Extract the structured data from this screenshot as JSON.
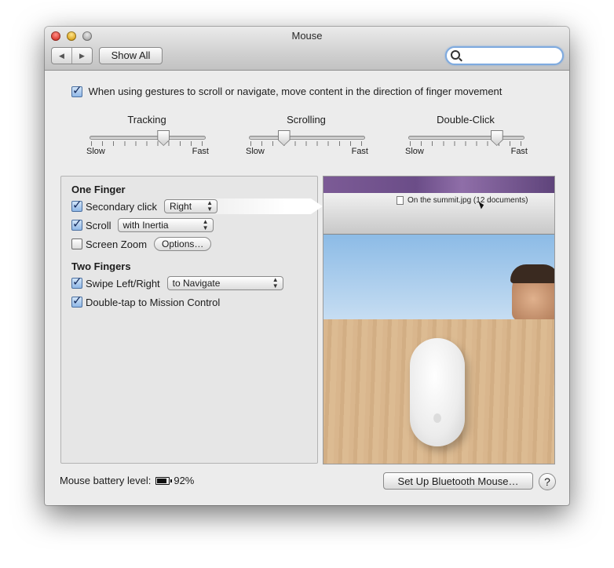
{
  "window": {
    "title": "Mouse"
  },
  "toolbar": {
    "back_icon": "back-arrow-icon",
    "forward_icon": "forward-arrow-icon",
    "show_all_label": "Show All",
    "search": {
      "placeholder": "",
      "value": ""
    }
  },
  "natural_scroll": {
    "checked": true,
    "label": "When using gestures to scroll or navigate, move content in the direction of finger movement"
  },
  "sliders": [
    {
      "label": "Tracking",
      "min_label": "Slow",
      "max_label": "Fast",
      "level_percent": 65
    },
    {
      "label": "Scrolling",
      "min_label": "Slow",
      "max_label": "Fast",
      "level_percent": 30
    },
    {
      "label": "Double-Click",
      "min_label": "Slow",
      "max_label": "Fast",
      "level_percent": 78
    }
  ],
  "one_finger": {
    "heading": "One Finger",
    "secondary_click": {
      "checked": true,
      "label": "Secondary click",
      "value": "Right"
    },
    "scroll": {
      "checked": true,
      "label": "Scroll",
      "value": "with Inertia"
    },
    "screen_zoom": {
      "checked": false,
      "label": "Screen Zoom",
      "options_label": "Options…"
    }
  },
  "two_fingers": {
    "heading": "Two Fingers",
    "swipe": {
      "checked": true,
      "label": "Swipe Left/Right",
      "value": "to Navigate"
    },
    "double_tap": {
      "checked": true,
      "label": "Double-tap to Mission Control"
    }
  },
  "preview": {
    "document_caption": "On the summit.jpg (12 documents)"
  },
  "footer": {
    "battery_label": "Mouse battery level:",
    "battery_percent": "92%",
    "battery_level": 0.92,
    "bluetooth_button": "Set Up Bluetooth Mouse…",
    "help_label": "?"
  }
}
